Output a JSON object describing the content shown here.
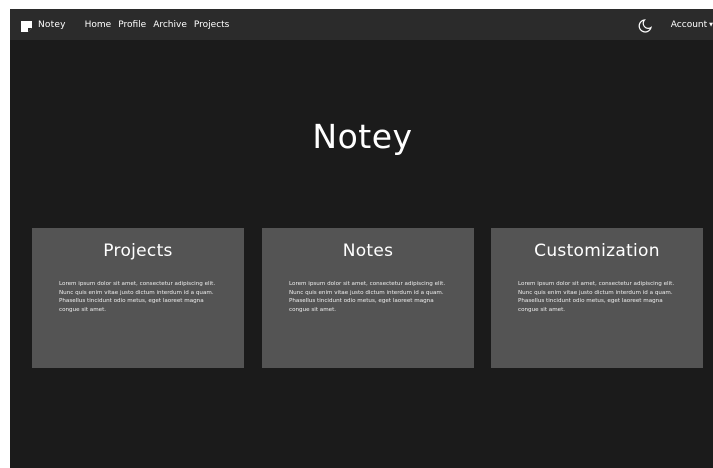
{
  "navbar": {
    "brand": "Notey",
    "links": [
      "Home",
      "Profile",
      "Archive",
      "Projects"
    ],
    "account_label": "Account",
    "icons": {
      "brand": "note-icon",
      "theme": "moon-icon",
      "dropdown": "caret-down-icon"
    }
  },
  "hero": {
    "title": "Notey"
  },
  "cards": [
    {
      "title": "Projects",
      "text": "Lorem ipsum dolor sit amet, consectetur adipiscing elit. Nunc quis enim vitae justo dictum interdum id a quam. Phasellus tincidunt odio metus, eget laoreet magna congue sit amet."
    },
    {
      "title": "Notes",
      "text": "Lorem ipsum dolor sit amet, consectetur adipiscing elit. Nunc quis enim vitae justo dictum interdum id a quam. Phasellus tincidunt odio metus, eget laoreet magna congue sit amet."
    },
    {
      "title": "Customization",
      "text": "Lorem ipsum dolor sit amet, consectetur adipiscing elit. Nunc quis enim vitae justo dictum interdum id a quam. Phasellus tincidunt odio metus, eget laoreet magna congue sit amet."
    }
  ],
  "colors": {
    "page_background": "#1b1b1b",
    "navbar_background": "#2b2b2b",
    "card_background": "#545454",
    "text": "#ffffff"
  }
}
